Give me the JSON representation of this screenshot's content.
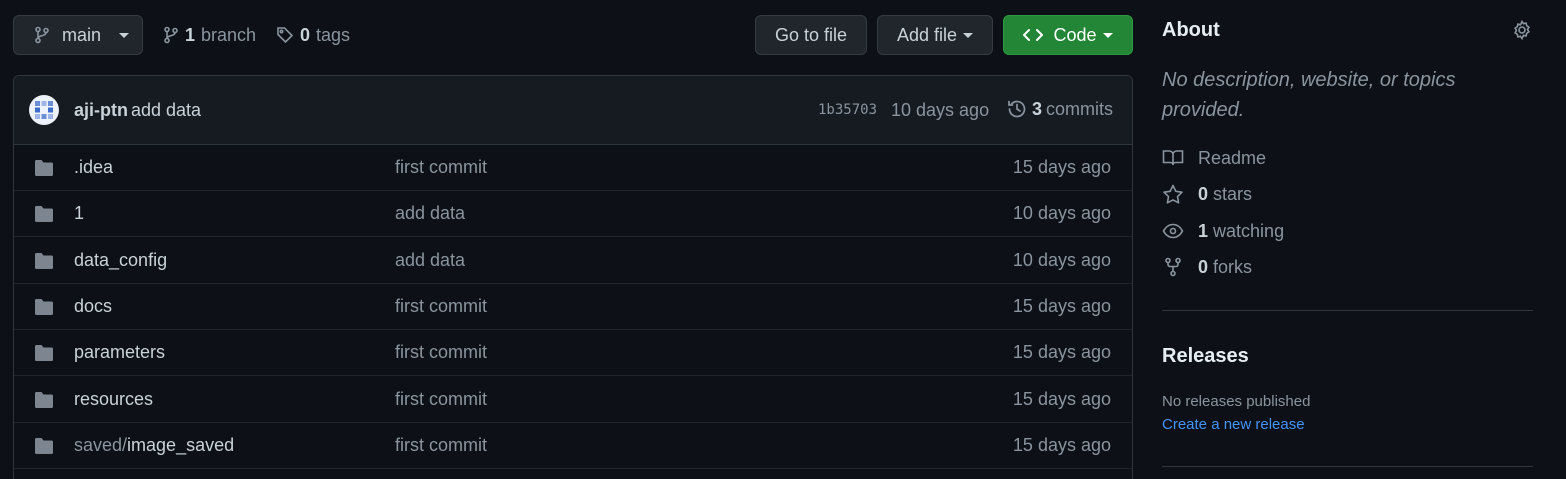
{
  "toolbar": {
    "branch_name": "main",
    "branch_count": "1",
    "branch_label": "branch",
    "tag_count": "0",
    "tag_label": "tags",
    "goto_file_label": "Go to file",
    "add_file_label": "Add file",
    "code_label": "Code"
  },
  "latest_commit": {
    "author": "aji-ptn",
    "message": "add data",
    "sha": "1b35703",
    "time": "10 days ago",
    "commit_count": "3",
    "commit_label": "commits"
  },
  "files": [
    {
      "prefix": "",
      "name": ".idea",
      "message": "first commit",
      "age": "15 days ago"
    },
    {
      "prefix": "",
      "name": "1",
      "message": "add data",
      "age": "10 days ago"
    },
    {
      "prefix": "",
      "name": "data_config",
      "message": "add data",
      "age": "10 days ago"
    },
    {
      "prefix": "",
      "name": "docs",
      "message": "first commit",
      "age": "15 days ago"
    },
    {
      "prefix": "",
      "name": "parameters",
      "message": "first commit",
      "age": "15 days ago"
    },
    {
      "prefix": "",
      "name": "resources",
      "message": "first commit",
      "age": "15 days ago"
    },
    {
      "prefix": "saved/",
      "name": "image_saved",
      "message": "first commit",
      "age": "15 days ago"
    }
  ],
  "about": {
    "title": "About",
    "description": "No description, website, or topics provided.",
    "readme_label": "Readme",
    "stars_count": "0",
    "stars_label": "stars",
    "watching_count": "1",
    "watching_label": "watching",
    "forks_count": "0",
    "forks_label": "forks"
  },
  "releases": {
    "title": "Releases",
    "empty_text": "No releases published",
    "create_link": "Create a new release"
  },
  "colors": {
    "background": "#0d1117",
    "code_button": "#238636",
    "link": "#4493f8",
    "folder_icon": "#7d8590"
  }
}
